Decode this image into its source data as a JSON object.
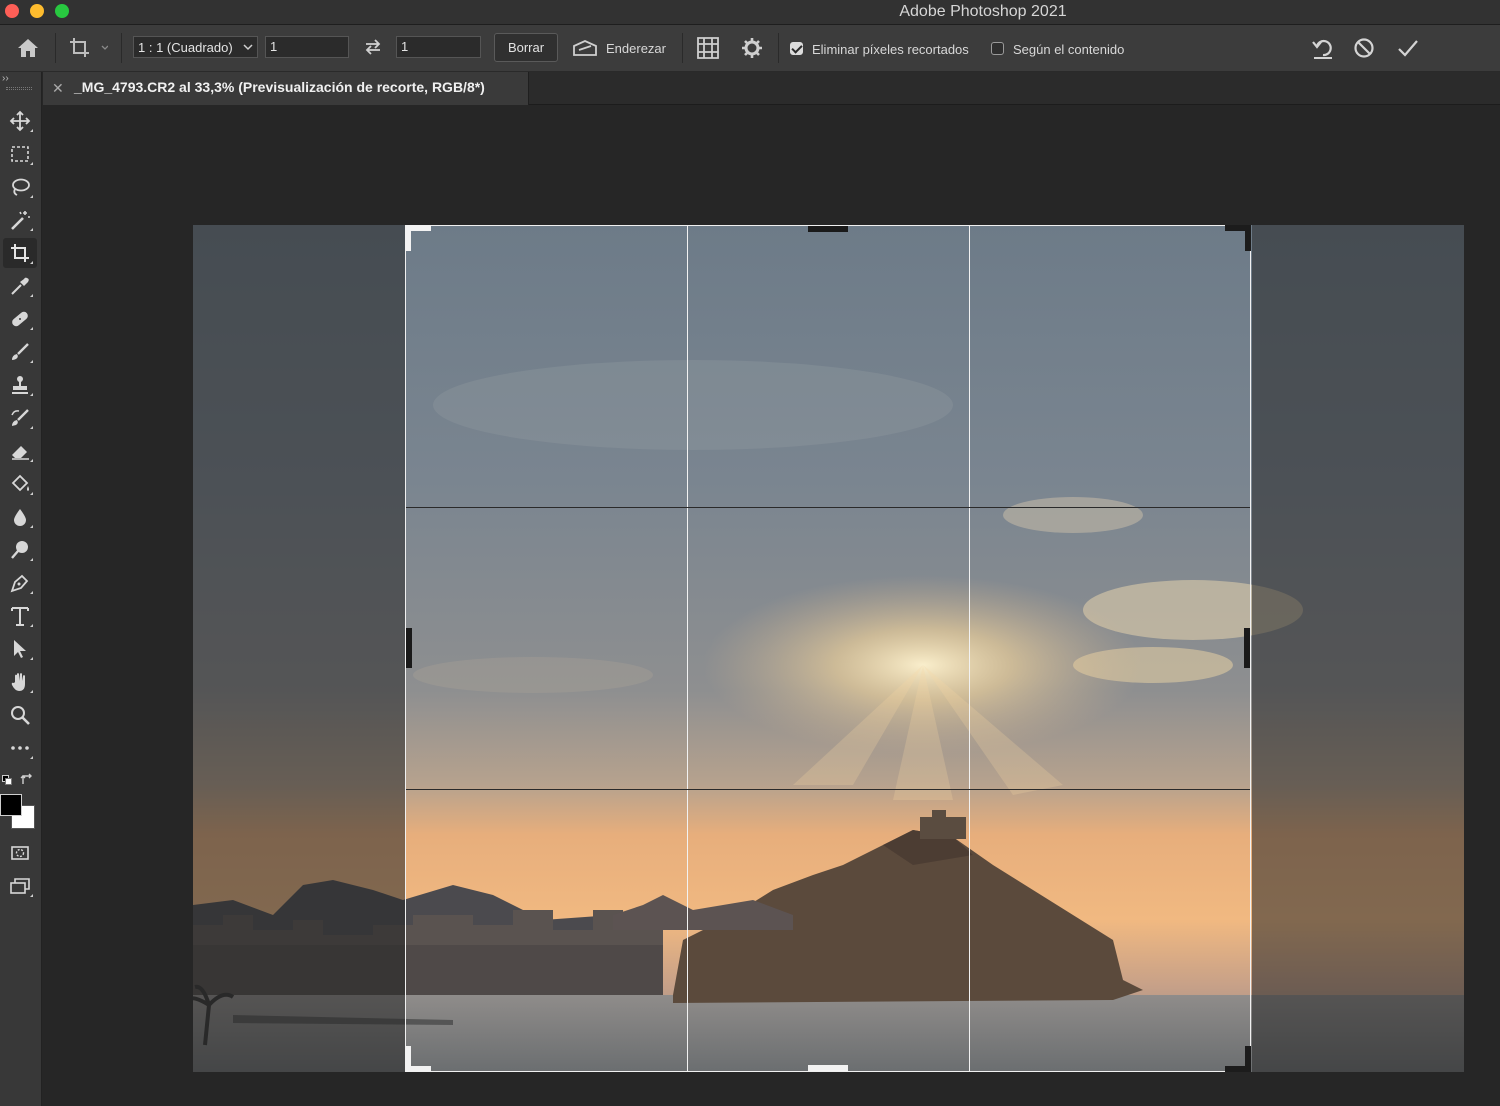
{
  "window": {
    "title": "Adobe Photoshop 2021"
  },
  "options_bar": {
    "aspect_ratio": "1 : 1 (Cuadrado)",
    "width_value": "1",
    "height_value": "1",
    "clear_label": "Borrar",
    "straighten_label": "Enderezar",
    "delete_cropped_label": "Eliminar píxeles recortados",
    "delete_cropped_checked": true,
    "content_aware_label": "Según el contenido",
    "content_aware_checked": false
  },
  "document_tab": {
    "title": "_MG_4793.CR2 al 33,3% (Previsualización de recorte, RGB/8*)"
  },
  "tools": [
    {
      "name": "move-tool",
      "icon": "move-icon"
    },
    {
      "name": "marquee-tool",
      "icon": "rectangular-marquee-icon"
    },
    {
      "name": "lasso-tool",
      "icon": "lasso-icon"
    },
    {
      "name": "magic-wand-tool",
      "icon": "magic-wand-icon"
    },
    {
      "name": "crop-tool",
      "icon": "crop-icon",
      "active": true
    },
    {
      "name": "eyedropper-tool",
      "icon": "eyedropper-icon"
    },
    {
      "name": "healing-tool",
      "icon": "bandage-icon"
    },
    {
      "name": "brush-tool",
      "icon": "brush-icon"
    },
    {
      "name": "stamp-tool",
      "icon": "stamp-icon"
    },
    {
      "name": "history-brush-tool",
      "icon": "history-brush-icon"
    },
    {
      "name": "eraser-tool",
      "icon": "eraser-icon"
    },
    {
      "name": "paint-bucket-tool",
      "icon": "paint-bucket-icon"
    },
    {
      "name": "blur-tool",
      "icon": "drop-icon"
    },
    {
      "name": "dodge-tool",
      "icon": "dodge-icon"
    },
    {
      "name": "pen-tool",
      "icon": "pen-icon"
    },
    {
      "name": "type-tool",
      "icon": "type-icon"
    },
    {
      "name": "path-selection-tool",
      "icon": "arrow-icon"
    },
    {
      "name": "hand-tool",
      "icon": "hand-icon"
    },
    {
      "name": "zoom-tool",
      "icon": "zoom-icon"
    },
    {
      "name": "more-tools",
      "icon": "ellipsis-icon"
    }
  ],
  "colors": {
    "foreground": "#000000",
    "background": "#ffffff"
  }
}
